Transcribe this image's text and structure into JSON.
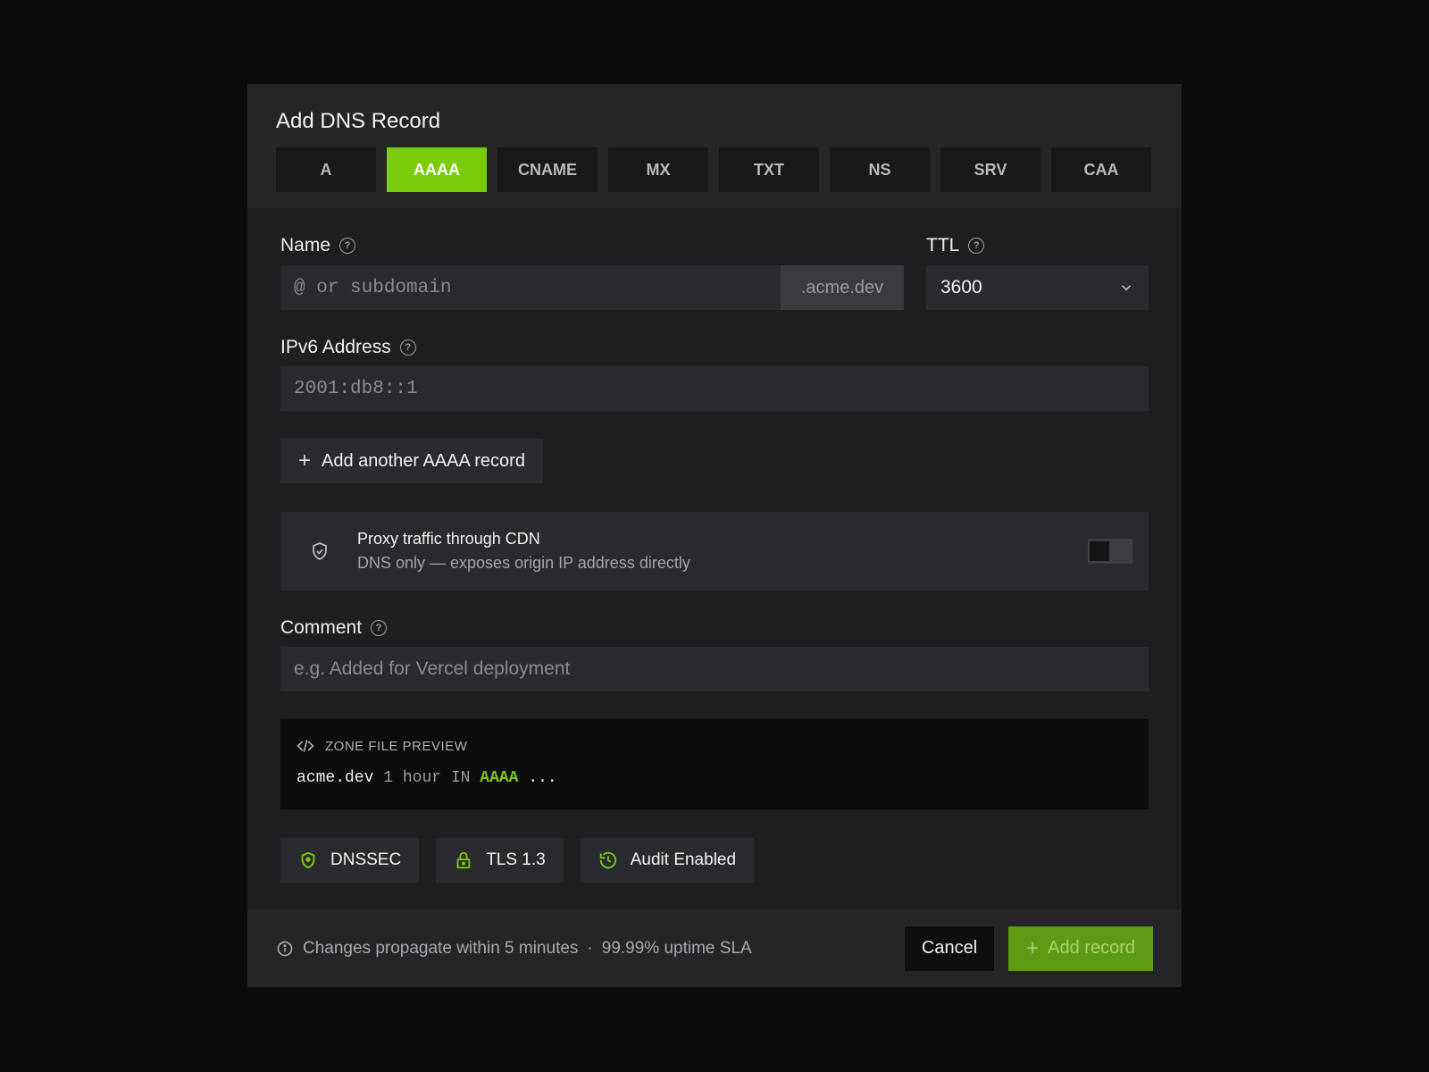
{
  "modal": {
    "title": "Add DNS Record",
    "tabs": [
      {
        "label": "A"
      },
      {
        "label": "AAAA",
        "active": true
      },
      {
        "label": "CNAME"
      },
      {
        "label": "MX"
      },
      {
        "label": "TXT"
      },
      {
        "label": "NS"
      },
      {
        "label": "SRV"
      },
      {
        "label": "CAA"
      }
    ]
  },
  "name": {
    "label": "Name",
    "placeholder": "@ or subdomain",
    "suffix": ".acme.dev"
  },
  "ttl": {
    "label": "TTL",
    "value": "3600"
  },
  "ipv6": {
    "label": "IPv6 Address",
    "placeholder": "2001:db8::1"
  },
  "add_another": {
    "icon": "plus-icon",
    "label": "Add another AAAA record"
  },
  "proxy": {
    "icon": "shield-icon",
    "title": "Proxy traffic through CDN",
    "subtitle": "DNS only — exposes origin IP address directly",
    "enabled": false
  },
  "comment": {
    "label": "Comment",
    "placeholder": "e.g. Added for Vercel deployment"
  },
  "preview": {
    "icon": "code-icon",
    "heading": "ZONE FILE PREVIEW",
    "host": "acme.dev",
    "ttl_text": "1 hour",
    "class_text": "IN",
    "type": "AAAA",
    "rest": "..."
  },
  "badges": [
    {
      "icon": "shield-check-icon",
      "label": "DNSSEC"
    },
    {
      "icon": "lock-icon",
      "label": "TLS 1.3"
    },
    {
      "icon": "history-icon",
      "label": "Audit Enabled"
    }
  ],
  "footer": {
    "info_icon": "info-icon",
    "info_text": "Changes propagate within 5 minutes",
    "separator": "·",
    "sla_text": "99.99% uptime SLA",
    "cancel_label": "Cancel",
    "add_label": "Add record"
  },
  "colors": {
    "accent": "#7ccc0e",
    "background": "#0b0b0d",
    "modal": "#1e1e21"
  }
}
